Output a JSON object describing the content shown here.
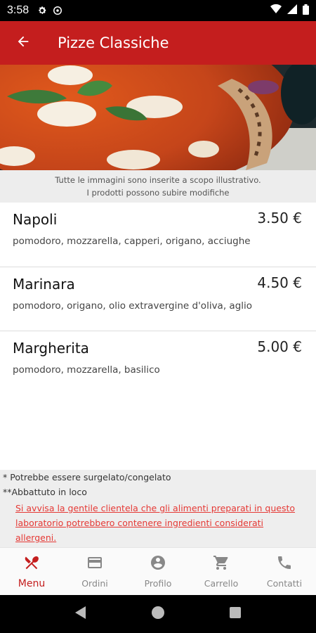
{
  "status_bar": {
    "time": "3:58",
    "icons": [
      "gear-icon",
      "sync-icon"
    ],
    "right_icons": [
      "wifi-icon",
      "signal-icon",
      "battery-icon"
    ]
  },
  "app_bar": {
    "title": "Pizze Classiche",
    "back_icon": "arrow-left-icon"
  },
  "disclaimer": {
    "line1": "Tutte le immagini sono inserite a scopo illustrativo.",
    "line2": "I prodotti possono subire modifiche"
  },
  "menu": {
    "items": [
      {
        "name": "Napoli",
        "price": "3.50 €",
        "desc": "pomodoro, mozzarella, capperi, origano, acciughe"
      },
      {
        "name": "Marinara",
        "price": "4.50 €",
        "desc": "pomodoro, origano, olio extravergine d'oliva, aglio"
      },
      {
        "name": "Margherita",
        "price": "5.00 €",
        "desc": "pomodoro, mozzarella, basilico"
      }
    ]
  },
  "notes": {
    "frozen": "* Potrebbe essere surgelato/congelato",
    "killed": "**Abbattuto in loco",
    "allergen_warning": "Si avvisa la gentile clientela che gli alimenti preparati in questo laboratorio potrebbero contenere ingredienti considerati allergeni."
  },
  "bottom_nav": {
    "items": [
      {
        "label": "Menu",
        "icon": "fork-knife-icon",
        "active": true
      },
      {
        "label": "Ordini",
        "icon": "credit-card-icon",
        "active": false
      },
      {
        "label": "Profilo",
        "icon": "account-circle-icon",
        "active": false
      },
      {
        "label": "Carrello",
        "icon": "cart-icon",
        "active": false
      },
      {
        "label": "Contatti",
        "icon": "phone-icon",
        "active": false
      }
    ]
  },
  "colors": {
    "primary": "#c41e1e",
    "warning": "#e53935",
    "inactive": "#888888"
  }
}
